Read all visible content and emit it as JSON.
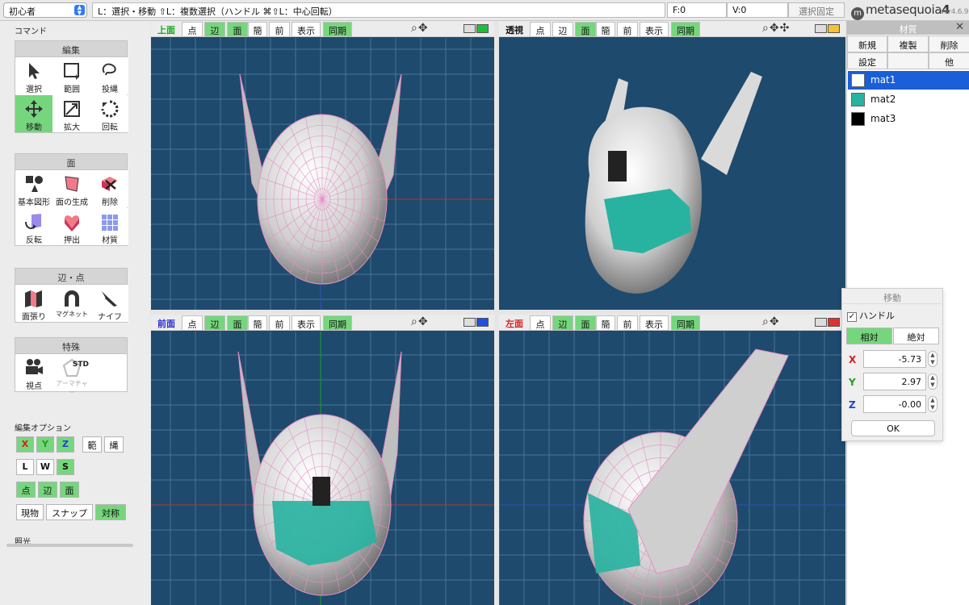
{
  "topbar": {
    "mode": "初心者",
    "hint": "L：選択・移動  ⇧L：複数選択（ハンドル  ⌘⇧L：中心回転）",
    "faces": "F:0",
    "vertices": "V:0",
    "lock": "選択固定",
    "logo": "metasequoia",
    "logo_num": "4",
    "version": "Ver4.6.9"
  },
  "sidebar": {
    "command_label": "コマンド",
    "groups": [
      {
        "title": "編集",
        "tools": [
          {
            "label": "選択",
            "icon": "cursor-icon"
          },
          {
            "label": "範囲",
            "icon": "rect-select-icon"
          },
          {
            "label": "投縄",
            "icon": "lasso-icon"
          },
          {
            "label": "移動",
            "icon": "move-icon",
            "active": true
          },
          {
            "label": "拡大",
            "icon": "scale-icon"
          },
          {
            "label": "回転",
            "icon": "rotate-icon"
          }
        ]
      },
      {
        "title": "面",
        "tools": [
          {
            "label": "基本図形",
            "icon": "primitive-icon"
          },
          {
            "label": "面の生成",
            "icon": "create-face-icon"
          },
          {
            "label": "削除",
            "icon": "delete-icon"
          },
          {
            "label": "反転",
            "icon": "flip-icon"
          },
          {
            "label": "押出",
            "icon": "extrude-icon"
          },
          {
            "label": "材質",
            "icon": "material-icon"
          }
        ]
      },
      {
        "title": "辺・点",
        "tools": [
          {
            "label": "面張り",
            "icon": "stretch-icon"
          },
          {
            "label": "マグネット",
            "icon": "magnet-icon"
          },
          {
            "label": "ナイフ",
            "icon": "knife-icon"
          }
        ]
      },
      {
        "title": "特殊",
        "tools": [
          {
            "label": "視点",
            "icon": "camera-icon"
          },
          {
            "label": "アーマチャー",
            "icon": "armature-icon",
            "disabled": true,
            "badge": "STD"
          }
        ]
      }
    ],
    "options_label": "編集オプション",
    "axes": [
      "X",
      "Y",
      "Z"
    ],
    "range": "範",
    "lasso": "縄",
    "space": [
      "L",
      "W",
      "S"
    ],
    "elements": [
      "点",
      "辺",
      "面"
    ],
    "current": "現物",
    "snap": "スナップ",
    "symmetry": "対称",
    "light_label": "照光"
  },
  "viewports": [
    {
      "id": "top",
      "title": "上面",
      "title_color": "#14a81e",
      "monitor_color": "#1cbf3a",
      "buttons": [
        "点",
        "辺",
        "面",
        "簡",
        "前",
        "表示"
      ],
      "sync": "同期",
      "active": [
        1,
        2
      ]
    },
    {
      "id": "persp",
      "title": "透視",
      "title_color": "#111111",
      "monitor_color": "#f2c230",
      "buttons": [
        "点",
        "辺",
        "面",
        "簡",
        "前",
        "表示"
      ],
      "sync": "同期",
      "active": [
        2
      ]
    },
    {
      "id": "front",
      "title": "前面",
      "title_color": "#2a2ad0",
      "monitor_color": "#2050e0",
      "buttons": [
        "点",
        "辺",
        "面",
        "簡",
        "前",
        "表示"
      ],
      "sync": "同期",
      "active": [
        1,
        2
      ]
    },
    {
      "id": "left",
      "title": "左面",
      "title_color": "#d82020",
      "monitor_color": "#e03030",
      "buttons": [
        "点",
        "辺",
        "面",
        "簡",
        "前",
        "表示"
      ],
      "sync": "同期",
      "active": [
        1,
        2
      ]
    }
  ],
  "materials": {
    "title": "材質",
    "new": "新規",
    "copy": "複製",
    "delete": "削除",
    "settings": "設定",
    "other": "他",
    "items": [
      {
        "name": "mat1",
        "color": "#ffffff",
        "selected": true
      },
      {
        "name": "mat2",
        "color": "#27b3a0"
      },
      {
        "name": "mat3",
        "color": "#000000"
      }
    ]
  },
  "move_dialog": {
    "title": "移動",
    "handle": "ハンドル",
    "relative": "相対",
    "absolute": "絶対",
    "x": "-5.73",
    "y": "2.97",
    "z": "-0.00",
    "ok": "OK",
    "x_color": "#d02020",
    "y_color": "#20a020",
    "z_color": "#2040d0"
  }
}
